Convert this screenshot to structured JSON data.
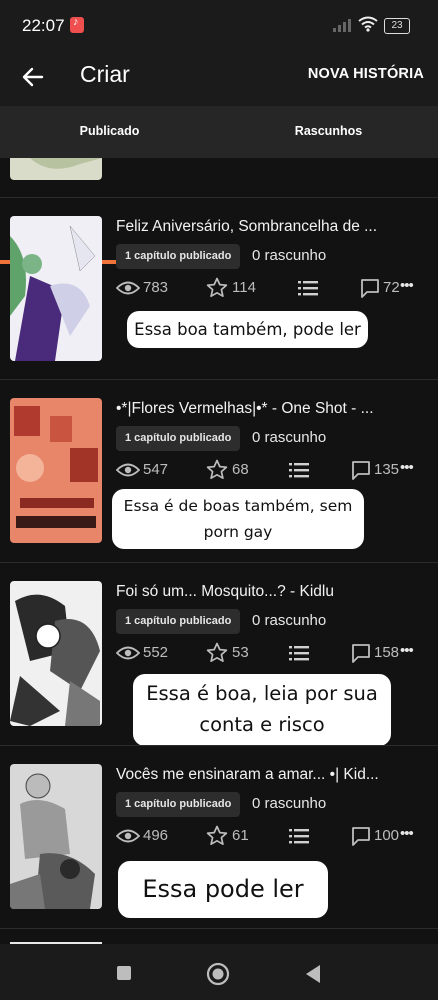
{
  "status_bar": {
    "time": "22:07",
    "battery": "23"
  },
  "header": {
    "title": "Criar",
    "new_story": "NOVA HISTÓRIA"
  },
  "tabs": [
    {
      "label": "Publicado"
    },
    {
      "label": "Rascunhos"
    }
  ],
  "stories": [
    {
      "title": "Feliz Aniversário, Sombrancelha de ...",
      "published_badge": "1 capítulo publicado",
      "drafts": "0 rascunho",
      "views": "783",
      "stars": "114",
      "comments": "72",
      "overlay_text": "Essa boa também, pode ler"
    },
    {
      "title": "•*|Flores Vermelhas|•* - One Shot - ...",
      "published_badge": "1 capítulo publicado",
      "drafts": "0 rascunho",
      "views": "547",
      "stars": "68",
      "comments": "135",
      "overlay_text": "Essa é de boas também, sem porn gay"
    },
    {
      "title": "Foi só um... Mosquito...? - Kidlu",
      "published_badge": "1 capítulo publicado",
      "drafts": "0 rascunho",
      "views": "552",
      "stars": "53",
      "comments": "158",
      "overlay_text": "Essa é boa, leia por sua conta e risco"
    },
    {
      "title": "Vocês me ensinaram a amar... •| Kid...",
      "published_badge": "1 capítulo publicado",
      "drafts": "0 rascunho",
      "views": "496",
      "stars": "61",
      "comments": "100",
      "overlay_text": "Essa pode ler"
    }
  ],
  "colors": {
    "accent": "#f0743a",
    "background": "#121212",
    "surface": "#1b1b1b"
  },
  "icons": [
    "back-arrow-icon",
    "eye-icon",
    "star-icon",
    "list-icon",
    "comment-icon",
    "more-icon",
    "nav-square-icon",
    "nav-home-icon",
    "nav-back-icon"
  ]
}
